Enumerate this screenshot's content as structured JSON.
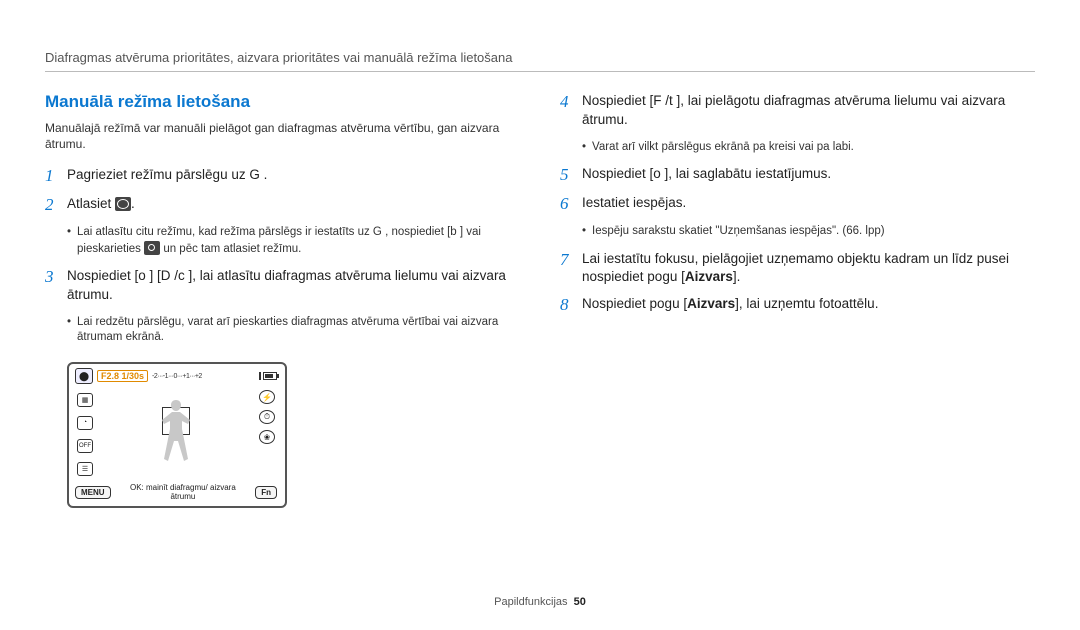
{
  "breadcrumb": "Diafragmas atvēruma prioritātes, aizvara prioritātes vai manuālā režīma lietošana",
  "section_title": "Manuālā režīma lietošana",
  "intro": "Manuālajā režīmā var manuāli pielāgot gan diafragmas atvēruma vērtību, gan aizvara ātrumu.",
  "steps": {
    "s1": "Pagrieziet režīmu pārslēgu uz G        .",
    "s2_a": "Atlasiet ",
    "s2_b": ".",
    "s2_sub": "Lai atlasītu citu režīmu, kad režīma pārslēgs ir iestatīts uz G        , nospiediet [b        ] vai pieskarieties ",
    "s2_sub_b": " un pēc tam atlasiet režīmu.",
    "s3": "Nospiediet [o       ]  [D          /c    ], lai atlasītu diafragmas atvēruma lielumu vai aizvara ātrumu.",
    "s3_sub": "Lai redzētu pārslēgu, varat arī pieskarties diafragmas atvēruma vērtībai vai aizvara ātrumam ekrānā.",
    "s4": "Nospiediet [F   /t     ], lai pielāgotu diafragmas atvēruma lielumu vai aizvara ātrumu.",
    "s4_sub": "Varat arī vilkt  pārslēgus ekrānā pa kreisi vai pa labi.",
    "s5": "Nospiediet [o      ], lai saglabātu iestatījumus.",
    "s6": "Iestatiet iespējas.",
    "s6_sub": "Iespēju sarakstu skatiet \"Uzņemšanas iespējas\". (66. lpp)",
    "s7_a": "Lai iestatītu fokusu, pielāgojiet uzņemamo objektu kadram un līdz pusei nospiediet pogu [",
    "s7_bold": "Aizvars",
    "s7_b": "].",
    "s8_a": "Nospiediet pogu [",
    "s8_bold": "Aizvars",
    "s8_b": "], lai uzņemtu fotoattēlu."
  },
  "numbers": {
    "n1": "1",
    "n2": "2",
    "n3": "3",
    "n4": "4",
    "n5": "5",
    "n6": "6",
    "n7": "7",
    "n8": "8"
  },
  "lcd": {
    "mode": "⬤",
    "exposure": "F2.8 1/30s",
    "ev": "-2···-1···0···+1···+2",
    "menu": "MENU",
    "fn": "Fn",
    "hint": "OK: mainīt diafragmu/ aizvara ātrumu",
    "flash": "⚡",
    "timer": "⏱",
    "macro": "❀"
  },
  "footer": {
    "section": "Papildfunkcijas",
    "page": "50"
  }
}
